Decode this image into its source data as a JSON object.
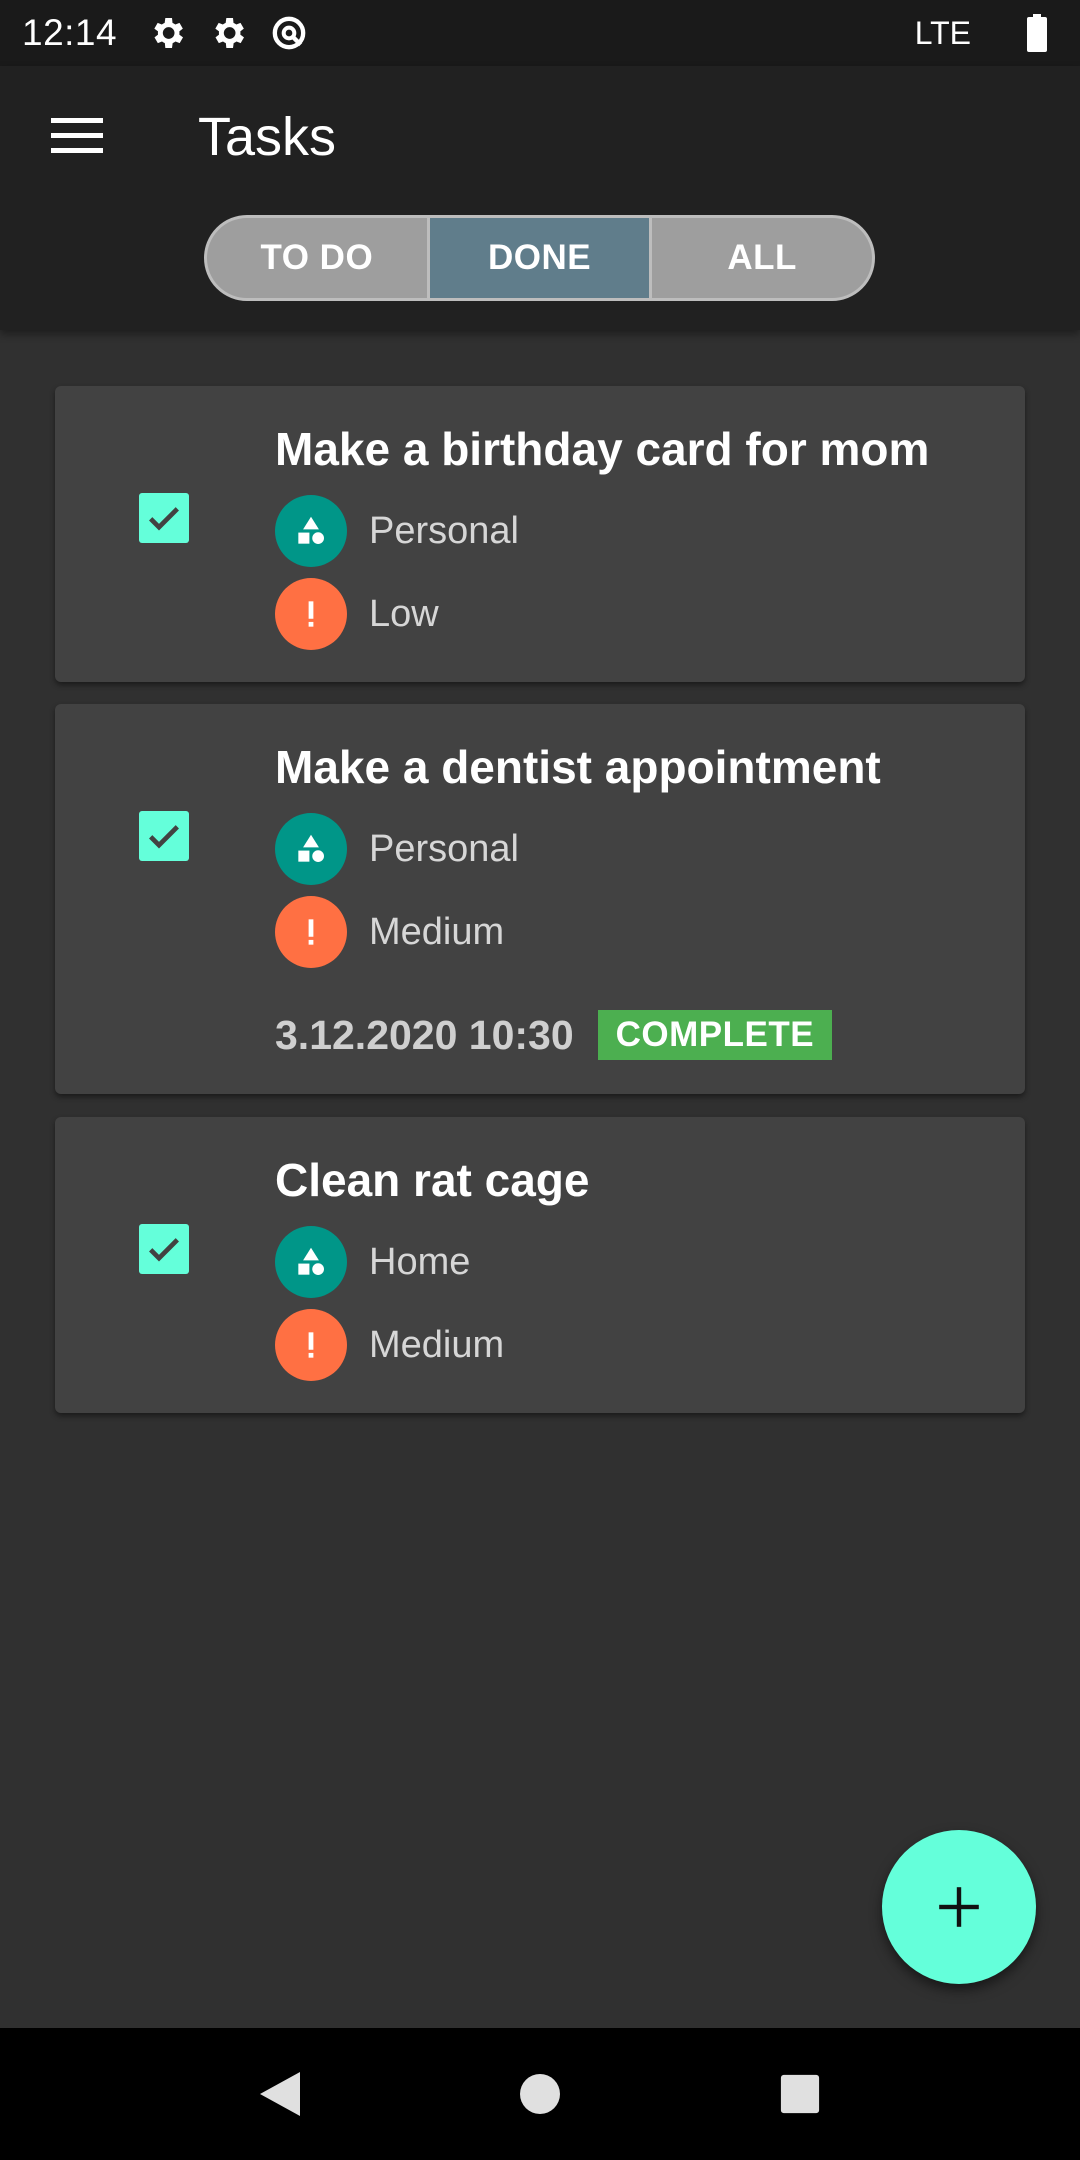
{
  "status_bar": {
    "time": "12:14",
    "network": "LTE",
    "icons": [
      "settings-icon",
      "settings-icon",
      "data-saver-icon",
      "battery-icon"
    ]
  },
  "app_bar": {
    "title": "Tasks",
    "menu_icon": "menu-icon"
  },
  "filter_tabs": [
    {
      "label": "TO DO",
      "active": false
    },
    {
      "label": "DONE",
      "active": true
    },
    {
      "label": "ALL",
      "active": false
    }
  ],
  "tasks": [
    {
      "title": "Make a birthday card for mom",
      "checked": true,
      "category": "Personal",
      "priority": "Low"
    },
    {
      "title": "Make a dentist appointment",
      "checked": true,
      "category": "Personal",
      "priority": "Medium",
      "due": "3.12.2020 10:30",
      "status": "COMPLETE"
    },
    {
      "title": "Clean rat cage",
      "checked": true,
      "category": "Home",
      "priority": "Medium"
    }
  ],
  "colors": {
    "accent": "#64ffda",
    "segment_active": "#607d8b",
    "category": "#009688",
    "priority": "#ff7043",
    "complete_badge": "#4caf50"
  },
  "fab": {
    "icon": "plus-icon"
  },
  "nav_bar": {
    "icons": [
      "back-icon",
      "home-icon",
      "recents-icon"
    ]
  }
}
